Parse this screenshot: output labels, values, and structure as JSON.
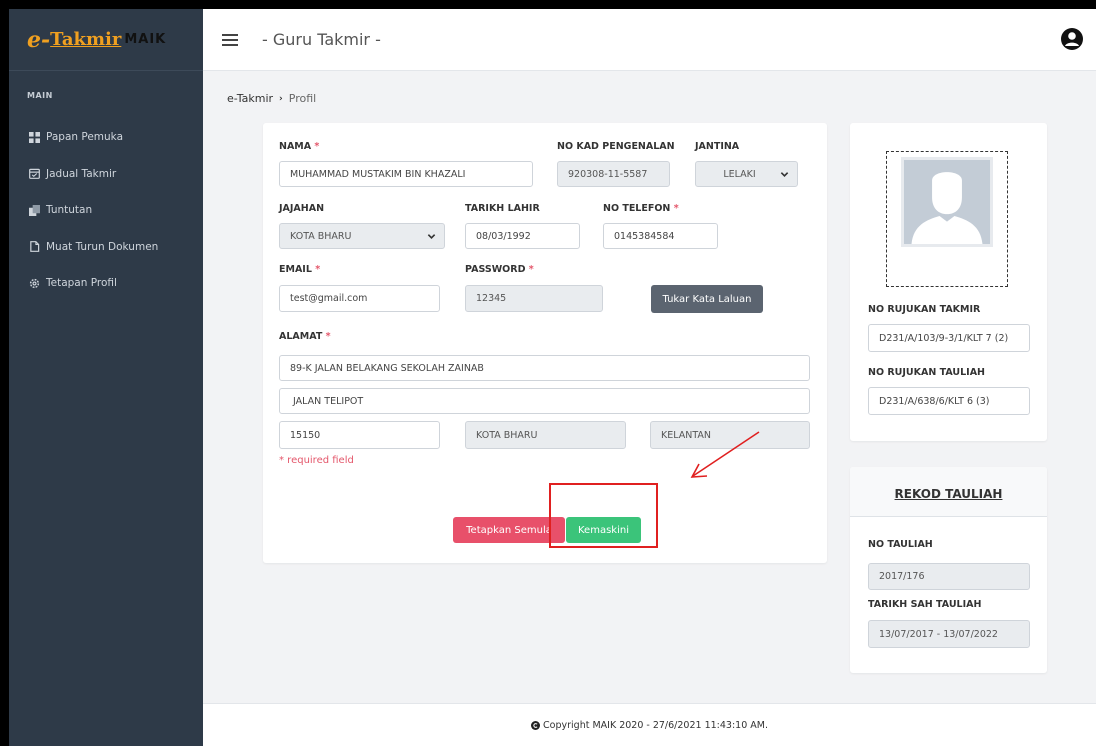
{
  "sidebar": {
    "logo": {
      "prefix": "e-",
      "name": "Takmir",
      "suffix": "MAIK"
    },
    "section": "MAIN",
    "items": [
      {
        "label": "Papan Pemuka",
        "icon": "dashboard-icon"
      },
      {
        "label": "Jadual Takmir",
        "icon": "calendar-icon"
      },
      {
        "label": "Tuntutan",
        "icon": "copy-icon"
      },
      {
        "label": "Muat Turun Dokumen",
        "icon": "document-icon"
      },
      {
        "label": "Tetapan Profil",
        "icon": "gear-icon"
      }
    ]
  },
  "header": {
    "title": "- Guru Takmir -",
    "user_icon": "user-circle-icon"
  },
  "breadcrumb": {
    "root": "e-Takmir",
    "separator": "›",
    "current": "Profil"
  },
  "form": {
    "nama": {
      "label": "NAMA",
      "required": "*",
      "value": "MUHAMMAD MUSTAKIM BIN KHAZALI"
    },
    "no_kad": {
      "label": "NO KAD PENGENALAN",
      "value": "920308-11-5587"
    },
    "jantina": {
      "label": "JANTINA",
      "value": "LELAKI"
    },
    "jajahan": {
      "label": "JAJAHAN",
      "value": "KOTA BHARU"
    },
    "tarikh_lahir": {
      "label": "TARIKH LAHIR",
      "value": "08/03/1992"
    },
    "no_telefon": {
      "label": "NO TELEFON",
      "required": "*",
      "value": "0145384584"
    },
    "email": {
      "label": "EMAIL",
      "required": "*",
      "value": "test@gmail.com"
    },
    "password": {
      "label": "PASSWORD",
      "required": "*",
      "value": "12345"
    },
    "tukar_button": "Tukar Kata Laluan",
    "alamat": {
      "label": "ALAMAT",
      "required": "*",
      "line1": "89-K JALAN BELAKANG SEKOLAH ZAINAB",
      "line2": " JALAN TELIPOT",
      "poskod": "15150",
      "bandar": "KOTA BHARU",
      "negeri": "KELANTAN"
    },
    "required_note": "* required field",
    "reset_button": "Tetapkan Semula",
    "update_button": "Kemaskini"
  },
  "profile": {
    "photo_icon": "user-silhouette-icon",
    "no_rujukan_takmir": {
      "label": "NO RUJUKAN TAKMIR",
      "value": "D231/A/103/9-3/1/KLT 7 (2)"
    },
    "no_rujukan_tauliah": {
      "label": "NO RUJUKAN TAULIAH",
      "value": "D231/A/638/6/KLT 6 (3)"
    }
  },
  "rekod": {
    "title": "REKOD TAULIAH",
    "no_tauliah": {
      "label": "NO TAULIAH",
      "value": "2017/176"
    },
    "tarikh_sah": {
      "label": "TARIKH SAH TAULIAH",
      "value": "13/07/2017 - 13/07/2022"
    }
  },
  "footer": {
    "text": "Copyright MAIK 2020 - 27/6/2021 11:43:10 AM."
  },
  "colors": {
    "sidebar": "#2e3a48",
    "accent": "#f0a020",
    "danger": "#e8506a",
    "success": "#3bc47a",
    "annotation": "#e02020"
  }
}
